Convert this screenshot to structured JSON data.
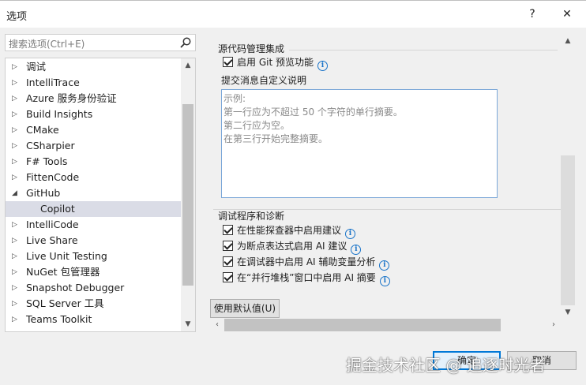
{
  "window": {
    "title": "选项",
    "help": "?",
    "close": "✕"
  },
  "search": {
    "placeholder": "搜索选项(Ctrl+E)"
  },
  "tree": {
    "items": [
      {
        "label": "调试",
        "expanded": false
      },
      {
        "label": "IntelliTrace",
        "expanded": false
      },
      {
        "label": "Azure 服务身份验证",
        "expanded": false
      },
      {
        "label": "Build Insights",
        "expanded": false
      },
      {
        "label": "CMake",
        "expanded": false
      },
      {
        "label": "CSharpier",
        "expanded": false
      },
      {
        "label": "F# Tools",
        "expanded": false
      },
      {
        "label": "FittenCode",
        "expanded": false
      },
      {
        "label": "GitHub",
        "expanded": true
      },
      {
        "label": "Copilot",
        "child": true,
        "selected": true
      },
      {
        "label": "IntelliCode",
        "expanded": false
      },
      {
        "label": "Live Share",
        "expanded": false
      },
      {
        "label": "Live Unit Testing",
        "expanded": false
      },
      {
        "label": "NuGet 包管理器",
        "expanded": false
      },
      {
        "label": "Snapshot Debugger",
        "expanded": false
      },
      {
        "label": "SQL Server 工具",
        "expanded": false
      },
      {
        "label": "Teams Toolkit",
        "expanded": false
      }
    ]
  },
  "source_control": {
    "heading": "源代码管理集成",
    "git_preview": "启用 Git 预览功能",
    "commit_label": "提交消息自定义说明",
    "example_lines": [
      "示例:",
      "第一行应为不超过 50 个字符的单行摘要。",
      "第二行应为空。",
      "在第三行开始完整摘要。"
    ]
  },
  "debugger": {
    "heading": "调试程序和诊断",
    "options": [
      "在性能探查器中启用建议",
      "为断点表达式启用 AI 建议",
      "在调试器中启用 AI 辅助变量分析",
      "在“并行堆栈”窗口中启用 AI 摘要"
    ]
  },
  "buttons": {
    "defaults": "使用默认值(U)",
    "ok": "确定",
    "cancel": "取消"
  },
  "watermark": "掘金技术社区 @ 追逐时光者",
  "colors": {
    "accent": "#0078d7",
    "info": "#1a74c9",
    "selection": "#dadce6"
  }
}
